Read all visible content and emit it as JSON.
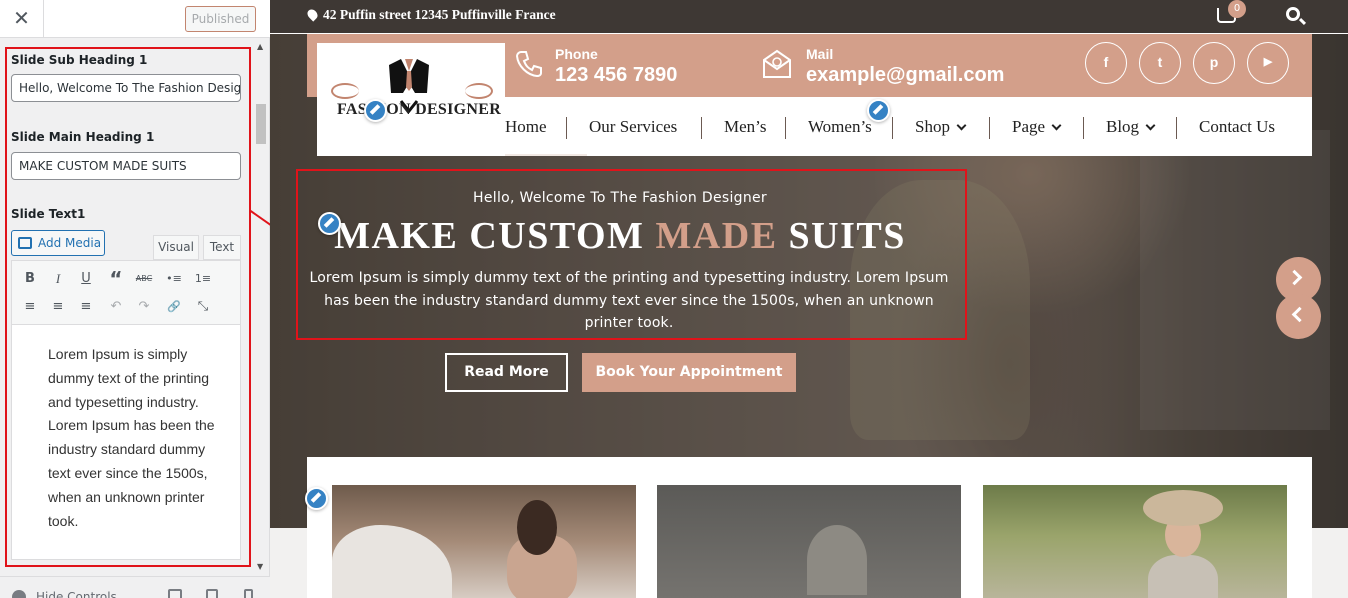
{
  "sidebar": {
    "close_label": "✕",
    "publish_button": "Published",
    "fields": {
      "sub_heading_label": "Slide Sub Heading 1",
      "sub_heading_value": "Hello, Welcome To The Fashion Design",
      "main_heading_label": "Slide Main Heading 1",
      "main_heading_value": "MAKE CUSTOM MADE SUITS",
      "text_label": "Slide Text1"
    },
    "editor": {
      "add_media": "Add Media",
      "tab_visual": "Visual",
      "tab_text": "Text",
      "toolbar_row1": [
        "B",
        "I",
        "U",
        "“",
        "ABC",
        "•≡",
        "1≡"
      ],
      "toolbar_row2": [
        "≡",
        "≡",
        "≡",
        "↶",
        "↷",
        "🔗",
        "⤡"
      ],
      "content": "Lorem Ipsum is simply dummy text of the printing and typesetting industry. Lorem Ipsum has been the industry standard dummy text ever since the 1500s, when an unknown printer took."
    },
    "footer": {
      "hide_controls": "Hide Controls"
    }
  },
  "site": {
    "topbar": {
      "address": "42 Puffin street 12345 Puffinville France",
      "cart_count": "0"
    },
    "header": {
      "logo_text": "FASHION DESIGNER",
      "phone_label": "Phone",
      "phone_value": "123 456 7890",
      "mail_label": "Mail",
      "mail_value": "example@gmail.com",
      "social": [
        {
          "icon": "facebook-icon",
          "glyph": "f"
        },
        {
          "icon": "twitter-icon",
          "glyph": "t"
        },
        {
          "icon": "pinterest-icon",
          "glyph": "p"
        },
        {
          "icon": "youtube-icon",
          "glyph": "▶"
        }
      ]
    },
    "nav": {
      "items": [
        "Home",
        "Our Services",
        "Men’s",
        "Women’s",
        "Shop",
        "Page",
        "Blog",
        "Contact Us"
      ]
    },
    "hero": {
      "sub_heading": "Hello, Welcome To The Fashion Designer",
      "main_heading_part1": "MAKE CUSTOM ",
      "main_heading_accent": "MADE",
      "main_heading_part2": " SUITS",
      "text": "Lorem Ipsum is simply dummy text of the printing and typesetting industry. Lorem Ipsum has been the industry standard dummy text ever since the 1500s, when an unknown printer took.",
      "read_more": "Read More",
      "book": "Book Your Appointment"
    },
    "colors": {
      "accent": "#d39f8a",
      "topbar": "#3e3834",
      "highlight_red": "#e0131a",
      "wp_blue": "#3582c4"
    }
  }
}
